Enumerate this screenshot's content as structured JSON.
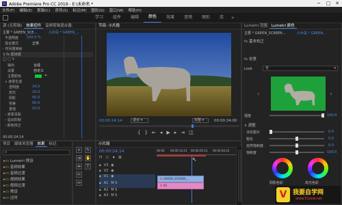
{
  "app_title": "Adobe Premiere Pro CC 2019 - E:\\未命名 *",
  "window_controls": [
    "─",
    "□",
    "✕"
  ],
  "menu": [
    "文件(F)",
    "编辑(E)",
    "剪辑(C)",
    "序列(S)",
    "标记(M)",
    "图形(G)",
    "窗口(W)",
    "帮助(H)"
  ],
  "workspaces": [
    "学习",
    "组件",
    "编辑",
    "颜色",
    "效果",
    "音频",
    "图形",
    "库"
  ],
  "active_workspace": "颜色",
  "left_panel": {
    "tabs": [
      "源:(无剪辑)",
      "效果控件",
      "音频剪辑混合器:"
    ],
    "clip": "主要 * GREEN_SCE...",
    "clip2": "小片段 * GREEN_...",
    "rows": [
      {
        "label": "不透明度",
        "value": "100.0 %",
        "type": "prop"
      },
      {
        "label": "混合模式",
        "value": "正常",
        "type": "prop"
      },
      {
        "label": "时间重映射",
        "value": "",
        "type": "group"
      },
      {
        "label": "超级键",
        "value": "",
        "type": "group"
      },
      {
        "label": "输出",
        "value": "合成",
        "type": "prop"
      },
      {
        "label": "设置",
        "value": "自定义",
        "type": "prop"
      },
      {
        "label": "主要颜色",
        "value": "",
        "type": "color"
      },
      {
        "label": "遮罩生成",
        "value": "",
        "type": "group"
      },
      {
        "label": "透明度",
        "value": "24.0",
        "type": "prop"
      },
      {
        "label": "高光",
        "value": "10.0",
        "type": "prop"
      },
      {
        "label": "阴影",
        "value": "50.0",
        "type": "prop"
      },
      {
        "label": "容差",
        "value": "50.0",
        "type": "prop"
      },
      {
        "label": "基值",
        "value": "10.0",
        "type": "prop"
      },
      {
        "label": "遮罩清除",
        "value": "",
        "type": "group"
      },
      {
        "label": "溢出抑制",
        "value": "",
        "type": "group"
      },
      {
        "label": "颜色校正",
        "value": "",
        "type": "group"
      }
    ],
    "time": "00:00:24:14"
  },
  "program": {
    "title": "节目: 小片段",
    "timecode": "00:00:24:14",
    "fit": "适合",
    "quality": "完整",
    "duration": "00:00:34:00"
  },
  "lumetri": {
    "tabs": [
      "Lumetri 范围",
      "Lumetri 颜色"
    ],
    "clip": "主要 * GREEN_SCREEN...",
    "clip2": "小片段 * GREEN...",
    "basic_correction": "基本校正",
    "creative": "创意",
    "look_label": "Look",
    "look_value": "无",
    "intensity_label": "强度",
    "intensity_value": "100.0",
    "adjust": "调整",
    "sliders": [
      {
        "label": "淡化胶片",
        "value": "0.0"
      },
      {
        "label": "锐化",
        "value": "0.0"
      },
      {
        "label": "自然饱和度",
        "value": "0.0"
      },
      {
        "label": "饱和度",
        "value": "100.0"
      }
    ],
    "wheel_labels": [
      "阴影色彩",
      "高光色彩"
    ]
  },
  "project": {
    "tabs": [
      "项目",
      "媒体浏览器",
      "效果",
      "标记"
    ],
    "items": [
      "Lumetri 预设",
      "音频效果",
      "音频过渡",
      "视频效果",
      "视频过渡",
      "预设",
      "过时"
    ]
  },
  "timeline": {
    "title": "小片段",
    "timecode": "00:00:24:14",
    "ticks": [
      "00:00",
      "00:00:14:23",
      "00:00:29:23",
      "00:00:44:22"
    ],
    "tracks": [
      "V3",
      "V2",
      "V1",
      "A1",
      "A2",
      "A3"
    ],
    "clip_label": "GREEN_SCREEN_...",
    "audio_label": "A1"
  },
  "watermark": {
    "line1": "我要自学网",
    "line2": "www.51zxw.net"
  }
}
